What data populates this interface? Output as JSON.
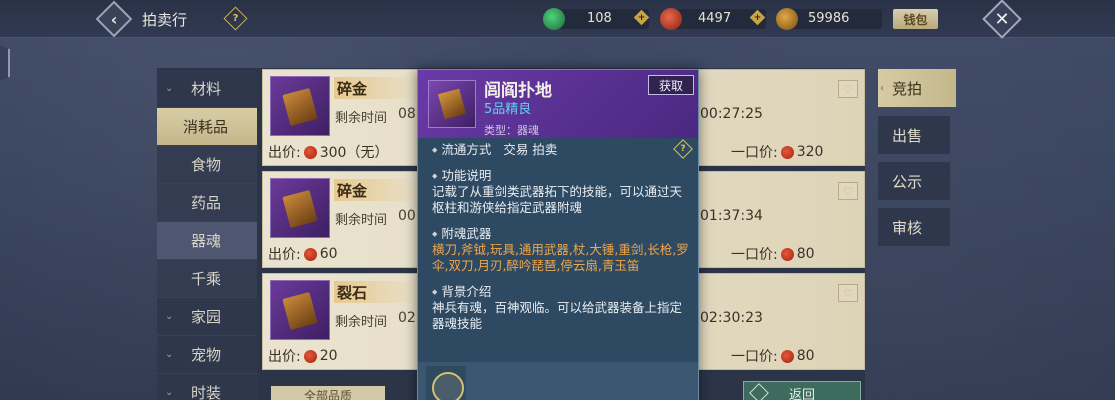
{
  "header": {
    "title": "拍卖行",
    "currencies": [
      {
        "name": "jade",
        "value": "108",
        "color": "#2fa15a"
      },
      {
        "name": "coin",
        "value": "4497",
        "color": "#c0392b"
      },
      {
        "name": "leaf",
        "value": "59986",
        "color": "#c08a2a"
      }
    ],
    "wallet_label": "钱包"
  },
  "sidebar": {
    "items": [
      {
        "label": "材料",
        "type": "category"
      },
      {
        "label": "消耗品",
        "type": "active"
      },
      {
        "label": "食物",
        "type": "sub"
      },
      {
        "label": "药品",
        "type": "sub"
      },
      {
        "label": "器魂",
        "type": "sub-selected"
      },
      {
        "label": "千乘",
        "type": "sub"
      },
      {
        "label": "家园",
        "type": "category"
      },
      {
        "label": "宠物",
        "type": "category"
      },
      {
        "label": "时装",
        "type": "category"
      }
    ]
  },
  "cards": [
    {
      "name": "碎金",
      "remain_label": "剩余时间",
      "remain_value": "08",
      "remain_right": "00:27:25",
      "price_label": "出价:",
      "price": "300（无）",
      "buyout_label": "一口价:",
      "buyout": "320"
    },
    {
      "name": "碎金",
      "remain_label": "剩余时间",
      "remain_value": "00",
      "remain_right": "01:37:34",
      "price_label": "出价:",
      "price": "60",
      "buyout_label": "一口价:",
      "buyout": "80"
    },
    {
      "name": "裂石",
      "remain_label": "剩余时间",
      "remain_value": "02",
      "remain_right": "02:30:23",
      "price_label": "出价:",
      "price": "20",
      "buyout_label": "一口价:",
      "buyout": "80"
    }
  ],
  "right_tabs": [
    "竞拍",
    "出售",
    "公示",
    "审核"
  ],
  "bottom": {
    "filter_label": "全部品质",
    "back_label": "返回"
  },
  "tooltip": {
    "name": "闾阎扑地",
    "grade": "5品精良",
    "type": "类型：器魂",
    "get_label": "获取",
    "flow_label": "流通方式",
    "flow_value": "交易 拍卖",
    "func_title": "功能说明",
    "func_text": "记载了从重剑类武器拓下的技能，可以通过天枢柱和游侠给指定武器附魂",
    "weapon_title": "附魂武器",
    "weapon_text": "横刀,斧钺,玩具,通用武器,杖,大锤,重剑,长枪,罗伞,双刀,月刃,醉吟琵琶,停云扇,青玉笛",
    "bg_title": "背景介绍",
    "bg_text": "神兵有魂，百神观临。可以给武器装备上指定器魂技能"
  }
}
